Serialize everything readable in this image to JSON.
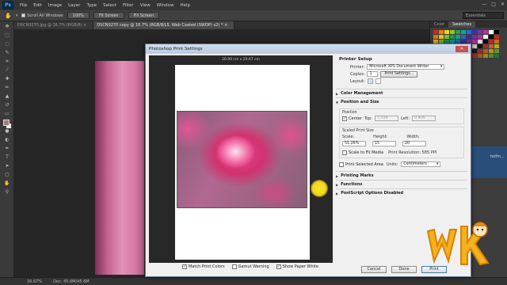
{
  "menubar": {
    "logo": "Ps",
    "items": [
      "File",
      "Edit",
      "Image",
      "Layer",
      "Type",
      "Select",
      "Filter",
      "View",
      "Window",
      "Help"
    ],
    "controls": [
      "—",
      "□",
      "✕"
    ]
  },
  "options_bar": {
    "scroll_all_windows": "Scroll All Windows",
    "zoom_100": "100%",
    "fit_screen": "Fit Screen",
    "fill_screen": "Fill Screen",
    "workspace": "Essentials"
  },
  "tabs": [
    {
      "label": "DSCN0270.jpg @ 16.7% (RGB/8) ×"
    },
    {
      "label": "DSCN0270 copy @ 16.7% (RGB/8/LS. Web Coated (SWOP) v2) * ×"
    }
  ],
  "right_panel": {
    "tabs": [
      "Color",
      "Swatches"
    ],
    "side_label": "hofm..."
  },
  "status": {
    "zoom": "16.67%",
    "doc": "Doc: 45.6M/45.6M"
  },
  "dialog": {
    "title": "Photoshop Print Settings",
    "close": "✕",
    "paper_dims": "20.99 cm x 29.67 cm",
    "printer_setup": {
      "title": "Printer Setup",
      "printer_label": "Printer:",
      "printer_value": "Microsoft XPS Document Writer",
      "copies_label": "Copies:",
      "copies_value": "1",
      "print_settings_btn": "Print Settings...",
      "layout_label": "Layout:"
    },
    "color_management": "Color Management",
    "position_size": {
      "title": "Position and Size",
      "position_label": "Position",
      "center_label": "Center",
      "top_label": "Top:",
      "top_value": "7.334",
      "left_label": "Left:",
      "left_value": "0.405",
      "scaled_label": "Scaled Print Size",
      "scale_label": "Scale:",
      "scale_value": "51.26%",
      "height_label": "Height:",
      "height_value": "15",
      "width_label": "Width:",
      "width_value": "20",
      "scale_to_fit": "Scale to Fit Media",
      "print_resolution": "Print Resolution: 585 PPI",
      "print_selected_area": "Print Selected Area",
      "units_label": "Units:",
      "units_value": "Centimeters"
    },
    "printing_marks": "Printing Marks",
    "functions": "Functions",
    "postscript": "PostScript Options Disabled",
    "match_print_colors": "Match Print Colors",
    "gamut_warning": "Gamut Warning",
    "show_paper_white": "Show Paper White",
    "buttons": {
      "cancel": "Cancel",
      "done": "Done",
      "print": "Print"
    }
  },
  "colors": {
    "accent": "#3c7fb1",
    "flower_pink": "#e83e8a",
    "cursor_yellow": "#f2d61a"
  }
}
